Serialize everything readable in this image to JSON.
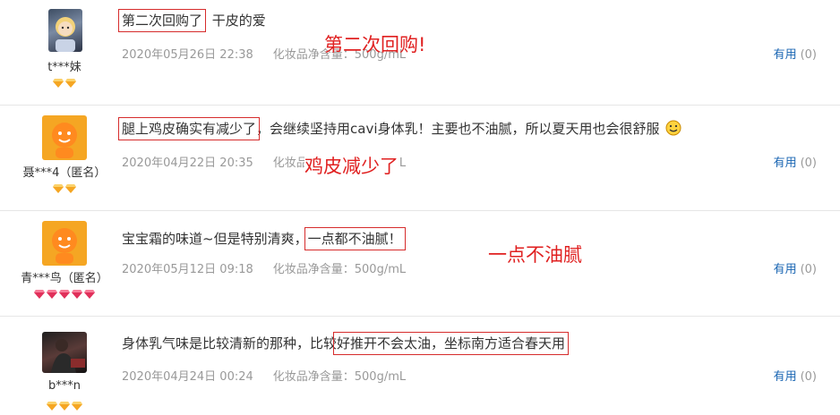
{
  "reviews": [
    {
      "user": "t***妹",
      "avatar": "photo-avatar-blonde",
      "badge_count": 2,
      "badge_color": "#f5a623",
      "comment_highlight": "第二次回购了",
      "comment_rest": "干皮的爱",
      "date": "2020年05月26日 22:38",
      "spec": "化妆品净含量：500g/mL",
      "useful_label": "有用",
      "useful_count": "(0)",
      "annotation": "第二次回购!"
    },
    {
      "user": "聂***4（匿名）",
      "avatar": "orange-mascot-avatar",
      "badge_count": 2,
      "badge_color": "#f5a623",
      "comment_highlight": "腿上鸡皮确实有减少了",
      "comment_rest": "，会继续坚持用cavi身体乳！主要也不油腻，所以夏天用也会很舒服",
      "date": "2020年04月22日 20:35",
      "spec": "化妆品净含量：500g/mL",
      "useful_label": "有用",
      "useful_count": "(0)",
      "annotation": "鸡皮减少了"
    },
    {
      "user": "青***鸟（匿名）",
      "avatar": "orange-mascot-avatar",
      "badge_count": 5,
      "badge_color": "#e0305a",
      "comment_before": "宝宝霜的味道~但是特别清爽，",
      "comment_highlight": "一点都不油腻！",
      "date": "2020年05月12日 09:18",
      "spec": "化妆品净含量：500g/mL",
      "useful_label": "有用",
      "useful_count": "(0)",
      "annotation": "一点不油腻"
    },
    {
      "user": "b***n",
      "avatar": "photo-avatar-dark",
      "badge_count": 3,
      "badge_color": "#f5a623",
      "comment_before": "身体乳气味是比较清新的那种，比较",
      "comment_highlight": "好推开不会太油，坐标南方适合春天用",
      "date": "2020年04月24日 00:24",
      "spec": "化妆品净含量：500g/mL",
      "useful_label": "有用",
      "useful_count": "(0)"
    }
  ]
}
